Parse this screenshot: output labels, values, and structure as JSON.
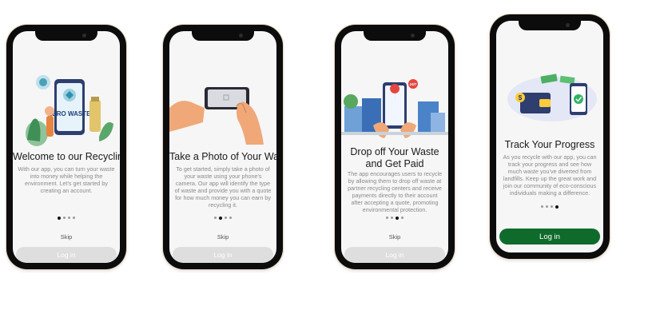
{
  "colors": {
    "primary": "#0f6b2c",
    "disabled_button": "#dedede",
    "frame": "#0c0c0c",
    "bezel_edge": "#e8d7c2"
  },
  "screens": [
    {
      "title": "Welcome to our Recycling App",
      "body": "With our app, you can turn your waste into money while helping the environment. Let's get started by creating an account.",
      "illustration_text": "ZERO WASTE",
      "illustration_icon": "zero-waste-phone-illustration",
      "active_dot": 0,
      "dot_count": 4,
      "skip": "Skip",
      "login": "Log in"
    },
    {
      "title": "Take a Photo of Your Waste",
      "body": "To get started, simply take a photo of your waste using your phone's camera. Our app will identify the type of waste and provide you with a quote for how much money you can earn by recycling it.",
      "illustration_icon": "hands-holding-phone-illustration",
      "active_dot": 1,
      "dot_count": 4,
      "skip": "Skip",
      "login": "Log in"
    },
    {
      "title": "Drop off Your Waste and Get Paid",
      "body": "The app encourages users to recycle by allowing them to drop off waste at partner recycling centers and receive payments directly to their account after accepting a quote, promoting environmental protection.",
      "illustration_text": "24/7",
      "illustration_icon": "city-map-phone-illustration",
      "active_dot": 2,
      "dot_count": 4,
      "skip": "Skip",
      "login": "Log in"
    },
    {
      "title": "Track Your Progress",
      "body": "As you recycle with our app, you can track your progress and see how much waste you've diverted from landfills. Keep up the great work and join our community of eco-conscious individuals making a difference.",
      "illustration_icon": "wallet-money-phone-illustration",
      "active_dot": 3,
      "dot_count": 4,
      "login": "Log in"
    }
  ]
}
